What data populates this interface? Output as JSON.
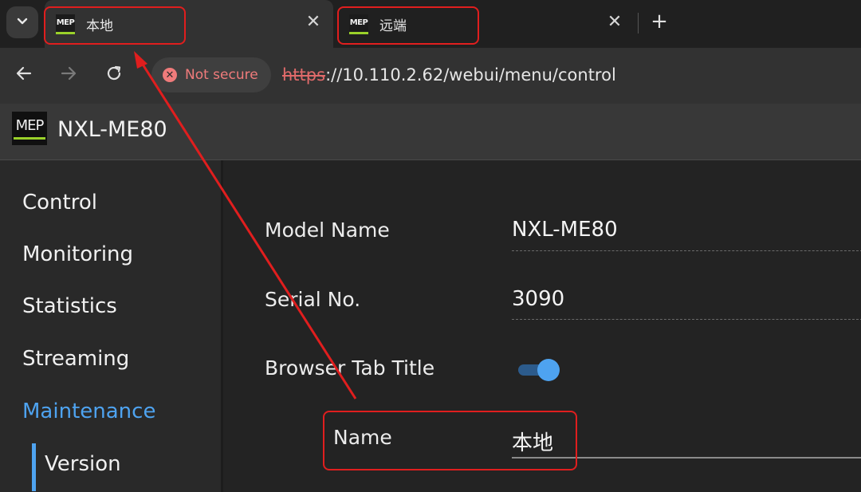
{
  "browser": {
    "tabs": [
      {
        "favicon_text": "MEP",
        "title": "本地",
        "active": true
      },
      {
        "favicon_text": "MEP",
        "title": "远端",
        "active": false
      }
    ],
    "new_tab_label": "+",
    "close_label": "✕",
    "security_chip": "Not secure",
    "url_scheme": "https",
    "url_rest": "://10.110.2.62/webui/menu/control"
  },
  "app": {
    "logo_text": "MEP",
    "title": "NXL-ME80"
  },
  "sidebar": {
    "items": [
      {
        "label": "Control",
        "active": false
      },
      {
        "label": "Monitoring",
        "active": false
      },
      {
        "label": "Statistics",
        "active": false
      },
      {
        "label": "Streaming",
        "active": false
      },
      {
        "label": "Maintenance",
        "active": true
      }
    ],
    "sub_items": [
      {
        "label": "Version",
        "active": true
      }
    ]
  },
  "form": {
    "model_name_label": "Model Name",
    "model_name_value": "NXL-ME80",
    "serial_label": "Serial No.",
    "serial_value": "3090",
    "tab_title_label": "Browser Tab Title",
    "tab_title_enabled": true,
    "name_label": "Name",
    "name_value": "本地"
  },
  "colors": {
    "accent": "#4ea3f0",
    "brand_green": "#9ad12a",
    "warning": "#f07b7b",
    "annotation": "#e01e1e"
  }
}
